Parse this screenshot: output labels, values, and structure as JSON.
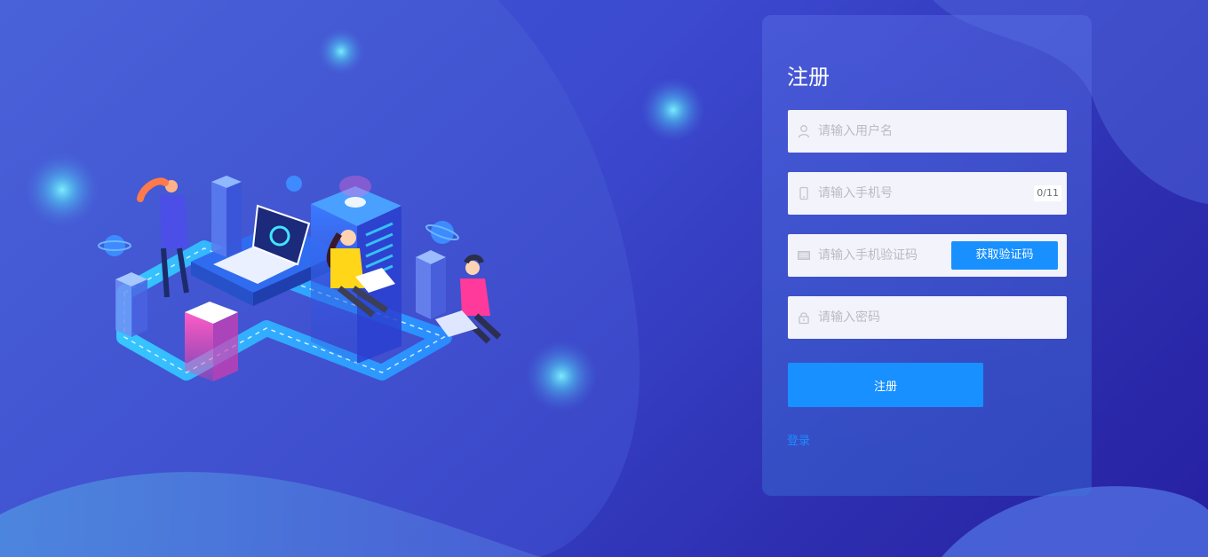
{
  "register_form": {
    "title": "注册",
    "username": {
      "placeholder": "请输入用户名",
      "value": ""
    },
    "phone": {
      "placeholder": "请输入手机号",
      "value": "",
      "counter": "0/11"
    },
    "sms_code": {
      "placeholder": "请输入手机验证码",
      "value": "",
      "button_label": "获取验证码"
    },
    "password": {
      "placeholder": "请输入密码",
      "value": ""
    },
    "submit_label": "注册",
    "login_link": "登录"
  },
  "icons": {
    "username": "user-icon",
    "phone": "mobile-phone-icon",
    "sms_code": "message-icon",
    "password": "lock-icon"
  },
  "colors": {
    "background_start": "#3f57d6",
    "background_end": "#2620a2",
    "primary": "#1890ff",
    "link": "#1b8cff",
    "input_bg": "#f3f3fb"
  }
}
